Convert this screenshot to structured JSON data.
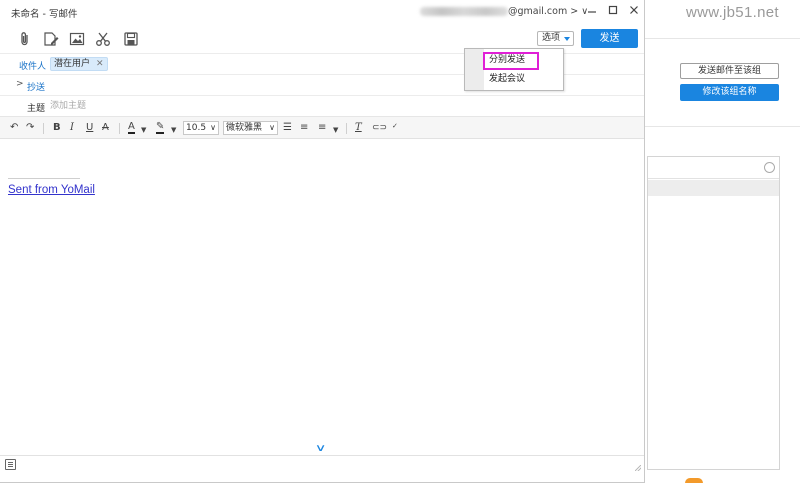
{
  "watermark": "www.jb51.net",
  "background_window": {
    "button_send_group": "发送邮件至该组",
    "button_rename_group": "修改该组名称"
  },
  "window": {
    "title": "未命名 - 写邮件",
    "account_suffix": "@gmail.com",
    "account_arrows": "> ∨"
  },
  "toolbar": {
    "icons": [
      "paperclip-icon",
      "document-edit-icon",
      "image-icon",
      "scissors-icon",
      "save-icon"
    ],
    "options_label": "选项",
    "send_label": "发送"
  },
  "header": {
    "to_label": "收件人",
    "to_recipient": "潜在用户",
    "cc_label": "抄送",
    "subject_label": "主题",
    "subject_placeholder": "添加主题"
  },
  "format": {
    "font_size": "10.5",
    "font_name": "微软雅黑"
  },
  "body": {
    "signature": "Sent from YoMail"
  },
  "dropdown": {
    "items": [
      "分别发送",
      "发起会议"
    ]
  },
  "colors": {
    "accent": "#1a85e0",
    "highlight_box": "#e01fd6",
    "link": "#3333cc"
  }
}
